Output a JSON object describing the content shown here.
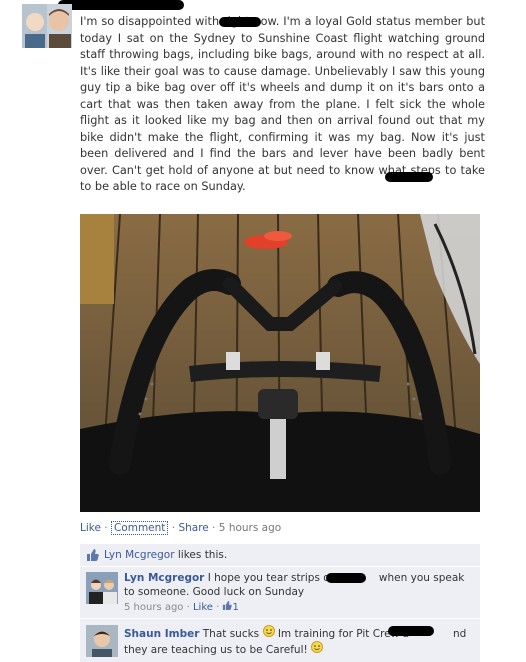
{
  "post": {
    "text": "I'm so disappointed with        right now. I'm a loyal Gold status member but today I sat on the Sydney to Sunshine Coast flight watching ground staff throwing bags, including bike bags, around with no respect at all. It's like their goal was to cause damage. Unbelievably I saw this young guy tip a bike bag over off it's wheels and dump it on it's bars onto a cart that was then taken away from the plane. I felt sick the whole flight as it looked like my bag and then on arrival found out that my bike didn't make the flight, confirming it was my bag. Now it's just been delivered and I find the bars and lever have been badly bent over. Can't get hold of anyone at        but need to know what steps to take to be able to race on Sunday."
  },
  "actions": {
    "like": "Like",
    "comment": "Comment",
    "share": "Share",
    "time": "5 hours ago",
    "dot": "·"
  },
  "likes": {
    "name": "Lyn Mcgregor",
    "suffix": " likes this."
  },
  "comments": [
    {
      "author": "Lyn Mcgregor",
      "text_a": " I hope you tear strips off",
      "text_b": "when you speak to someone. Good luck on Sunday",
      "time": "5 hours ago",
      "like": "Like",
      "like_count": "1"
    },
    {
      "author": "Shaun Imber",
      "text_a": " That sucks",
      "text_b": " Im training for Pit Crew a",
      "text_c": "nd they are teaching us to be Careful!"
    }
  ],
  "colors": {
    "link": "#3b5998",
    "ufi_bg": "#edeff4",
    "text": "#333333"
  }
}
